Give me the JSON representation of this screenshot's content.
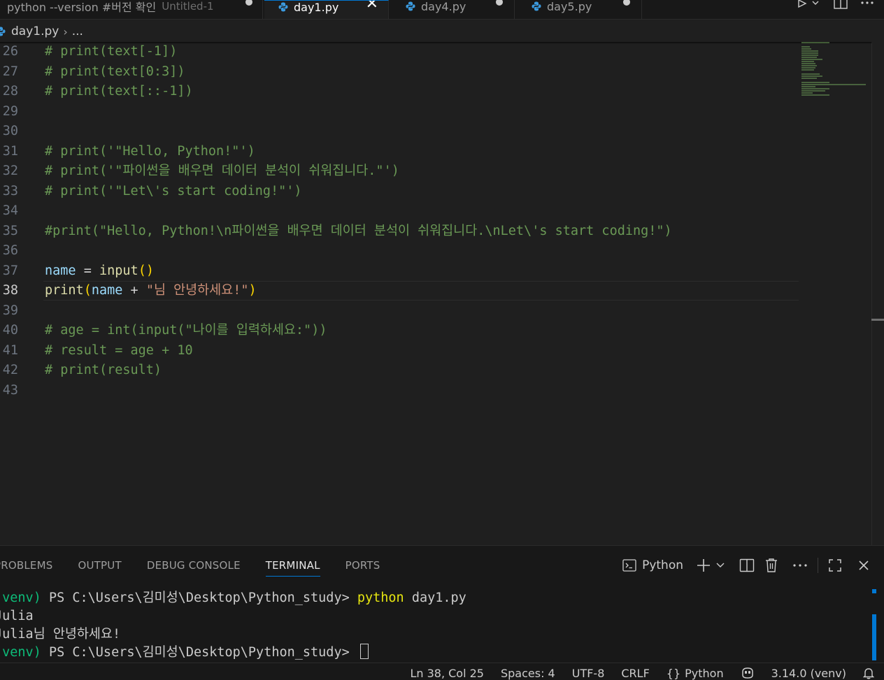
{
  "tabs": [
    {
      "label": "python --version #버전 확인",
      "description": "Untitled-1",
      "dirty": true,
      "active": false
    },
    {
      "label": "day1.py",
      "active": true,
      "close_icon": "close-icon"
    },
    {
      "label": "day4.py",
      "dirty": true,
      "active": false
    },
    {
      "label": "day5.py",
      "dirty": true,
      "active": false
    }
  ],
  "toolbar": {
    "run_icon": "play-icon",
    "split_icon": "split-editor-icon",
    "more_icon": "ellipsis-icon"
  },
  "breadcrumb": {
    "file": "day1.py",
    "rest": "..."
  },
  "editor": {
    "current_line": 38,
    "lines": [
      {
        "n": "26",
        "text": "# print(text[-1])"
      },
      {
        "n": "27",
        "text": "# print(text[0:3])"
      },
      {
        "n": "28",
        "text": "# print(text[::-1])"
      },
      {
        "n": "29",
        "text": ""
      },
      {
        "n": "30",
        "text": ""
      },
      {
        "n": "31",
        "text": "# print('\"Hello, Python!\"')"
      },
      {
        "n": "32",
        "text": "# print('\"파이썬을 배우면 데이터 분석이 쉬워집니다.\"')"
      },
      {
        "n": "33",
        "text": "# print('\"Let\\'s start coding!\"')"
      },
      {
        "n": "34",
        "text": ""
      },
      {
        "n": "35",
        "text": "#print(\"Hello, Python!\\n파이썬을 배우면 데이터 분석이 쉬워집니다.\\nLet\\'s start coding!\")"
      },
      {
        "n": "36",
        "text": ""
      },
      {
        "n": "37",
        "var": "name",
        "op": " = ",
        "fn": "input",
        "br": "()"
      },
      {
        "n": "38",
        "fn": "print",
        "open": "(",
        "var": "name",
        "op": " + ",
        "str": "\"님 안녕하세요!\"",
        "close": ")"
      },
      {
        "n": "39",
        "text": ""
      },
      {
        "n": "40",
        "text": "# age = int(input(\"나이를 입력하세요:\"))"
      },
      {
        "n": "41",
        "text": "# result = age + 10"
      },
      {
        "n": "42",
        "text": "# print(result)"
      },
      {
        "n": "43",
        "text": ""
      }
    ]
  },
  "panel": {
    "tabs": [
      "PROBLEMS",
      "OUTPUT",
      "DEBUG CONSOLE",
      "TERMINAL",
      "PORTS"
    ],
    "active_tab": "TERMINAL",
    "terminal_kind": "Python",
    "actions": [
      "terminal-icon",
      "add-icon",
      "chevron-down-icon",
      "split-terminal-icon",
      "trash-icon",
      "ellipsis-icon",
      "maximize-icon",
      "close-icon"
    ]
  },
  "terminal": {
    "venv": "(venv)",
    "prompt": " PS C:\\Users\\김미성\\Desktop\\Python_study> ",
    "command": "python",
    "args": " day1.py",
    "input_line": "Julia",
    "output_line": "Julia님 안녕하세요!"
  },
  "status": {
    "position": "Ln 38, Col 25",
    "spaces": "Spaces: 4",
    "encoding": "UTF-8",
    "eol": "CRLF",
    "language_braces": "{}",
    "language": "Python",
    "interpreter": "3.14.0 (venv)"
  },
  "colors": {
    "accent": "#0078d4",
    "comment": "#6a9955",
    "variable": "#9cdcfe",
    "function": "#dcdcaa",
    "string": "#ce9178",
    "bracket": "#ffd700",
    "venv_green": "#0dbc79",
    "command_yellow": "#e5e510"
  }
}
